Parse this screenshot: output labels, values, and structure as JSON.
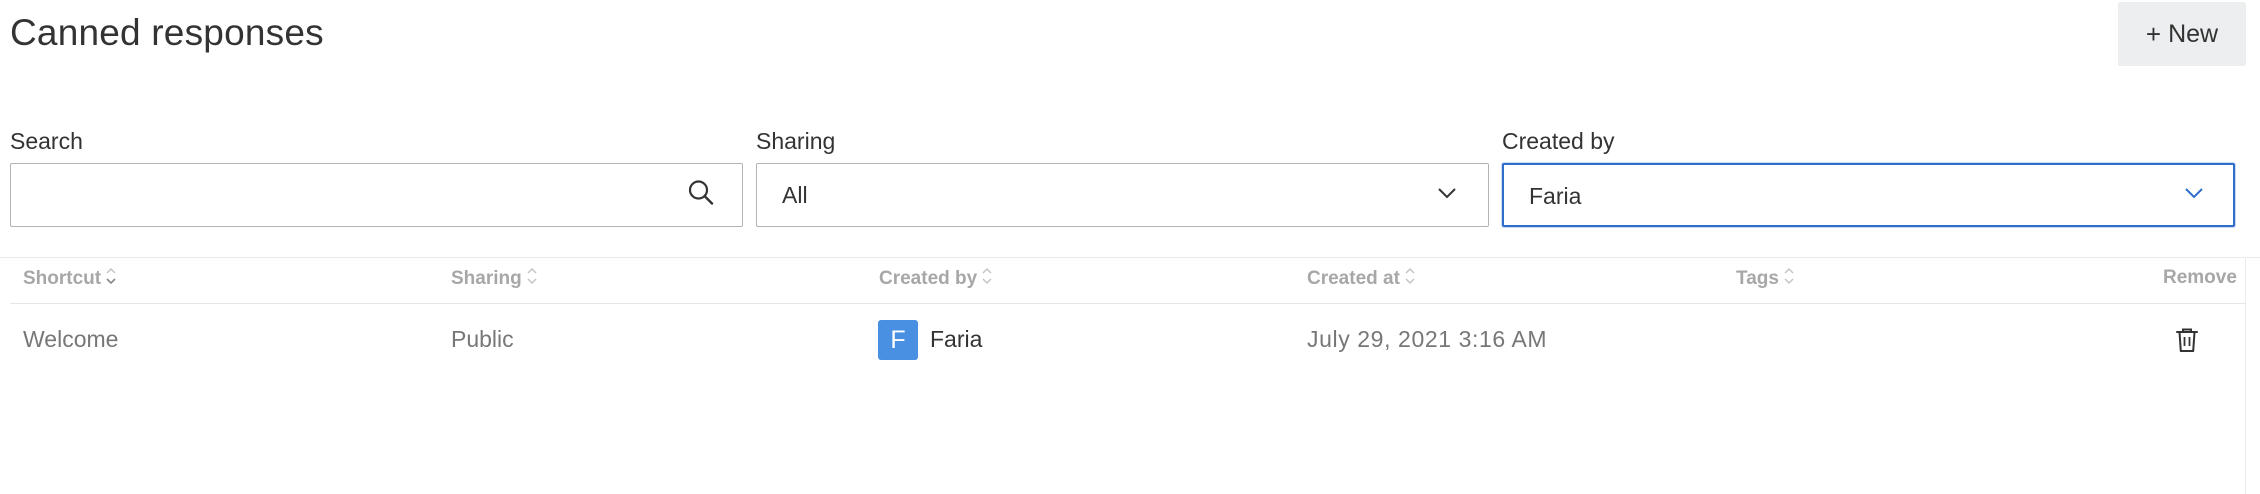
{
  "page": {
    "title": "Canned responses"
  },
  "toolbar": {
    "new_label": "New",
    "new_icon": "plus-icon"
  },
  "filters": {
    "search": {
      "label": "Search",
      "value": "",
      "placeholder": "",
      "icon": "search-icon"
    },
    "sharing": {
      "label": "Sharing",
      "selected": "All",
      "icon": "chevron-down-icon"
    },
    "created_by": {
      "label": "Created by",
      "selected": "Faria",
      "icon": "chevron-down-icon",
      "accent": "#2f6fcb"
    }
  },
  "table": {
    "columns": [
      {
        "key": "shortcut",
        "label": "Shortcut",
        "sort_icon": "sort-icon"
      },
      {
        "key": "sharing",
        "label": "Sharing",
        "sort_icon": "sort-icon"
      },
      {
        "key": "created_by",
        "label": "Created by",
        "sort_icon": "sort-icon"
      },
      {
        "key": "created_at",
        "label": "Created at",
        "sort_icon": "sort-icon"
      },
      {
        "key": "tags",
        "label": "Tags",
        "sort_icon": "sort-icon"
      },
      {
        "key": "remove",
        "label": "Remove"
      }
    ],
    "rows": [
      {
        "shortcut": "Welcome",
        "sharing": "Public",
        "created_by": {
          "initial": "F",
          "name": "Faria",
          "avatar_color": "#4a90e2"
        },
        "created_at": "July 29, 2021 3:16 AM",
        "tags": "",
        "remove_icon": "trash-icon"
      }
    ]
  }
}
